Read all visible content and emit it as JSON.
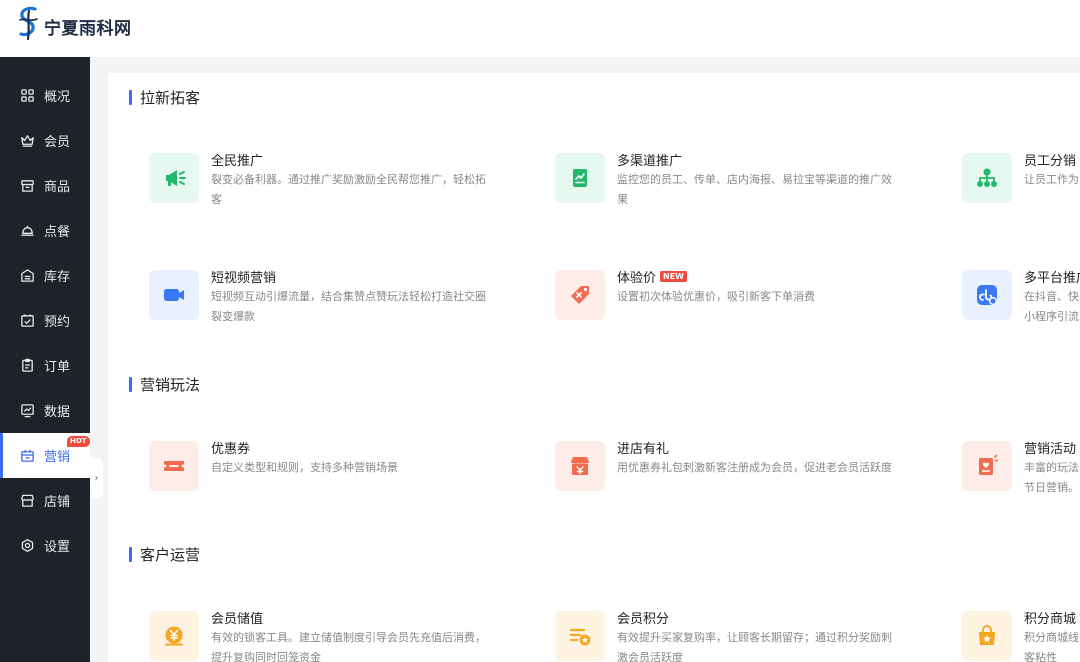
{
  "brand": {
    "name": "宁夏雨科网"
  },
  "sidebar": {
    "items": [
      {
        "label": "概况",
        "icon": "grid-icon"
      },
      {
        "label": "会员",
        "icon": "crown-icon"
      },
      {
        "label": "商品",
        "icon": "shop-box-icon"
      },
      {
        "label": "点餐",
        "icon": "cloche-icon"
      },
      {
        "label": "库存",
        "icon": "warehouse-icon"
      },
      {
        "label": "预约",
        "icon": "calendar-check-icon"
      },
      {
        "label": "订单",
        "icon": "clipboard-icon"
      },
      {
        "label": "数据",
        "icon": "chart-monitor-icon"
      },
      {
        "label": "营销",
        "icon": "gift-calendar-icon",
        "active": true,
        "badge": "HOT"
      },
      {
        "label": "店铺",
        "icon": "store-icon"
      },
      {
        "label": "设置",
        "icon": "settings-icon"
      }
    ],
    "collapse_glyph": "›"
  },
  "sections": [
    {
      "title": "拉新拓客",
      "cards": [
        {
          "title": "全民推广",
          "desc": "裂变必备利器。通过推广奖励激励全民帮您推广，轻松拓客",
          "icon": "megaphone-icon"
        },
        {
          "title": "多渠道推广",
          "desc": "监控您的员工、传单、店内海报、易拉宝等渠道的推广效果",
          "icon": "chart-doc-icon"
        },
        {
          "title": "员工分销",
          "desc": "让员工作为",
          "icon": "org-tree-icon"
        },
        {
          "title": "短视频营销",
          "desc": "短视频互动引爆流量，结合集赞点赞玩法轻松打造社交圈裂变爆款",
          "icon": "video-camera-icon"
        },
        {
          "title": "体验价",
          "badge": "NEW",
          "desc": "设置初次体验优惠价，吸引新客下单消费",
          "icon": "price-tag-icon"
        },
        {
          "title": "多平台推广",
          "desc": "在抖音、快\n小程序引流",
          "icon": "mini-program-icon"
        }
      ]
    },
    {
      "title": "营销玩法",
      "cards": [
        {
          "title": "优惠券",
          "desc": "自定义类型和规则，支持多种营销场景",
          "icon": "coupon-icon"
        },
        {
          "title": "进店有礼",
          "desc": "用优惠券礼包刺激新客注册成为会员，促进老会员活跃度",
          "icon": "gift-shop-icon"
        },
        {
          "title": "营销活动",
          "desc": "丰富的玩法\n节日营销。",
          "icon": "event-poster-icon"
        }
      ]
    },
    {
      "title": "客户运营",
      "cards": [
        {
          "title": "会员储值",
          "desc": "有效的锁客工具。建立储值制度引导会员先充值后消费，提升复购同时回笼资金",
          "icon": "yen-coin-icon"
        },
        {
          "title": "会员积分",
          "desc": "有效提升买家复购率，让顾客长期留存；通过积分奖励刺激会员活跃度",
          "icon": "points-list-icon"
        },
        {
          "title": "积分商城",
          "desc": "积分商城线\n客粘性",
          "icon": "shopping-bag-icon"
        }
      ]
    }
  ],
  "colors": {
    "accent": "#3a6cf6",
    "sidebar_bg": "#1e2229",
    "hot_badge": "#f04a3c",
    "green_icon": "#20b86b",
    "blue_icon": "#3a78f5",
    "orange_icon": "#f26c4f",
    "amber_icon": "#f5a623"
  }
}
